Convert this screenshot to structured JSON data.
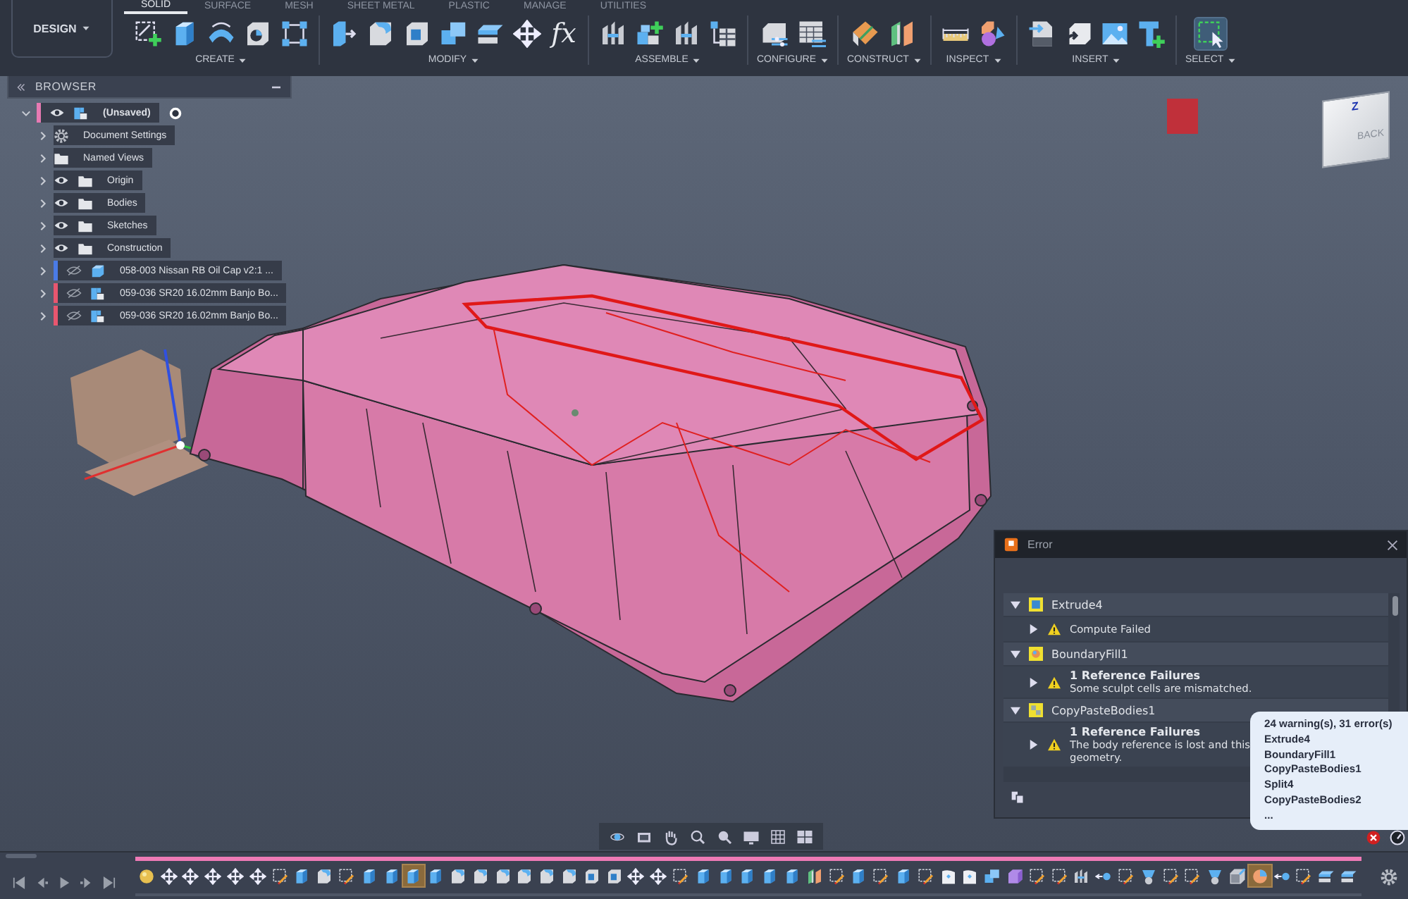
{
  "toolbar": {
    "workspace": "DESIGN",
    "tabs": [
      {
        "label": "SOLID",
        "selected": true
      },
      {
        "label": "SURFACE",
        "selected": false
      },
      {
        "label": "MESH",
        "selected": false
      },
      {
        "label": "SHEET METAL",
        "selected": false
      },
      {
        "label": "PLASTIC",
        "selected": false
      },
      {
        "label": "MANAGE",
        "selected": false
      },
      {
        "label": "UTILITIES",
        "selected": false
      }
    ],
    "groups": [
      {
        "label": "CREATE",
        "tools": [
          {
            "kind": "sketch",
            "selected": false
          },
          {
            "kind": "block",
            "selected": false
          },
          {
            "kind": "arch",
            "selected": false
          },
          {
            "kind": "hole",
            "selected": false
          },
          {
            "kind": "pattern",
            "selected": false
          }
        ]
      },
      {
        "label": "MODIFY",
        "tools": [
          {
            "kind": "presspull",
            "selected": false
          },
          {
            "kind": "fillet",
            "selected": false
          },
          {
            "kind": "shell",
            "selected": false
          },
          {
            "kind": "combine",
            "selected": false
          },
          {
            "kind": "offset",
            "selected": false
          },
          {
            "kind": "move",
            "selected": false
          },
          {
            "kind": "glyph",
            "glyph": "fx",
            "selected": false
          }
        ]
      },
      {
        "label": "ASSEMBLE",
        "tools": [
          {
            "kind": "joint",
            "selected": false
          },
          {
            "kind": "component",
            "selected": false
          },
          {
            "kind": "joint",
            "selected": false
          },
          {
            "kind": "table",
            "selected": false
          }
        ]
      },
      {
        "label": "CONFIGURE",
        "tools": [
          {
            "kind": "config",
            "selected": false
          },
          {
            "kind": "configtable",
            "selected": false
          }
        ]
      },
      {
        "label": "CONSTRUCT",
        "tools": [
          {
            "kind": "plane",
            "selected": false
          },
          {
            "kind": "panels",
            "selected": false
          }
        ]
      },
      {
        "label": "INSPECT",
        "tools": [
          {
            "kind": "measure",
            "selected": false
          },
          {
            "kind": "display",
            "selected": false
          }
        ]
      },
      {
        "label": "INSERT",
        "tools": [
          {
            "kind": "svg",
            "selected": false
          },
          {
            "kind": "decal",
            "selected": false
          },
          {
            "kind": "image",
            "selected": false
          },
          {
            "kind": "textcmd",
            "selected": false
          }
        ]
      },
      {
        "label": "SELECT",
        "tools": [
          {
            "kind": "select",
            "selected": true
          }
        ]
      }
    ]
  },
  "browser": {
    "title": "BROWSER",
    "tree": [
      {
        "label": "(Unsaved)",
        "kind": "component",
        "color": "#e77ab3",
        "visible": true,
        "active": true,
        "expanded": true,
        "children": [
          {
            "label": "Document Settings",
            "kind": "gear",
            "expanded": false
          },
          {
            "label": "Named Views",
            "kind": "folder",
            "expanded": false
          },
          {
            "label": "Origin",
            "kind": "folder",
            "visible": true,
            "expanded": false
          },
          {
            "label": "Bodies",
            "kind": "folder",
            "visible": true,
            "expanded": false
          },
          {
            "label": "Sketches",
            "kind": "folder",
            "visible": true,
            "expanded": false
          },
          {
            "label": "Construction",
            "kind": "folder",
            "visible": true,
            "expanded": false
          },
          {
            "label": "058-003 Nissan RB Oil Cap v2:1 ...",
            "kind": "body",
            "color": "#4a7be6",
            "visible": false,
            "expanded": false
          },
          {
            "label": "059-036 SR20 16.02mm Banjo Bo...",
            "kind": "component",
            "color": "#e8566f",
            "visible": false,
            "expanded": false
          },
          {
            "label": "059-036 SR20 16.02mm Banjo Bo...",
            "kind": "component",
            "color": "#e8566f",
            "visible": false,
            "expanded": false
          }
        ]
      }
    ]
  },
  "viewport": {
    "view_cube": {
      "face": "BACK",
      "axis": "Z"
    }
  },
  "error_dialog": {
    "title": "Error",
    "groups": [
      {
        "name": "Extrude4",
        "kind": "extrude",
        "expanded": true,
        "items": [
          {
            "expanded": false,
            "lines": [
              "Compute Failed"
            ]
          }
        ]
      },
      {
        "name": "BoundaryFill1",
        "kind": "boundary",
        "expanded": true,
        "items": [
          {
            "expanded": false,
            "heading": "1 Reference Failures",
            "lines": [
              "Some sculpt cells are mismatched."
            ]
          }
        ]
      },
      {
        "name": "CopyPasteBodies1",
        "kind": "copy",
        "expanded": true,
        "items": [
          {
            "expanded": false,
            "heading": "1 Reference Failures",
            "lines": [
              "The body reference is lost and this",
              "geometry."
            ]
          }
        ]
      }
    ]
  },
  "tooltip": {
    "lines": [
      "24 warning(s), 31 error(s)",
      "Extrude4",
      "BoundaryFill1",
      "CopyPasteBodies1",
      "Split4",
      "CopyPasteBodies2",
      "..."
    ]
  },
  "timeline": {
    "items": [
      {
        "kind": "appearance",
        "selected": false
      },
      {
        "kind": "move",
        "selected": false
      },
      {
        "kind": "move",
        "selected": false
      },
      {
        "kind": "move",
        "selected": false
      },
      {
        "kind": "move",
        "selected": false
      },
      {
        "kind": "move",
        "selected": false
      },
      {
        "kind": "sketchpen",
        "selected": false
      },
      {
        "kind": "block",
        "selected": false
      },
      {
        "kind": "fillet",
        "selected": false
      },
      {
        "kind": "sketchpen",
        "selected": false
      },
      {
        "kind": "block",
        "selected": false
      },
      {
        "kind": "block",
        "selected": false
      },
      {
        "kind": "block",
        "selected": true
      },
      {
        "kind": "block",
        "selected": false
      },
      {
        "kind": "fillet",
        "selected": false
      },
      {
        "kind": "fillet",
        "selected": false
      },
      {
        "kind": "fillet",
        "selected": false
      },
      {
        "kind": "fillet",
        "selected": false
      },
      {
        "kind": "fillet",
        "selected": false
      },
      {
        "kind": "fillet",
        "selected": false
      },
      {
        "kind": "shell",
        "selected": false
      },
      {
        "kind": "shell",
        "selected": false
      },
      {
        "kind": "move",
        "selected": false
      },
      {
        "kind": "move",
        "selected": false
      },
      {
        "kind": "sketchpen",
        "selected": false
      },
      {
        "kind": "block",
        "selected": false
      },
      {
        "kind": "block",
        "selected": false
      },
      {
        "kind": "block",
        "selected": false
      },
      {
        "kind": "block",
        "selected": false
      },
      {
        "kind": "block",
        "selected": false
      },
      {
        "kind": "panels",
        "selected": false
      },
      {
        "kind": "sketchpen",
        "selected": false
      },
      {
        "kind": "block",
        "selected": false
      },
      {
        "kind": "sketchpen",
        "selected": false
      },
      {
        "kind": "block",
        "selected": false
      },
      {
        "kind": "sketchpen",
        "selected": false
      },
      {
        "kind": "boundary",
        "selected": false
      },
      {
        "kind": "boundary",
        "selected": false
      },
      {
        "kind": "combine",
        "selected": false
      },
      {
        "kind": "box",
        "selected": false
      },
      {
        "kind": "sketchpen",
        "selected": false
      },
      {
        "kind": "sketchpen",
        "selected": false
      },
      {
        "kind": "joint",
        "selected": false
      },
      {
        "kind": "pointarrow",
        "selected": false
      },
      {
        "kind": "sketchpen",
        "selected": false
      },
      {
        "kind": "loft",
        "selected": false
      },
      {
        "kind": "sketchpen",
        "selected": false
      },
      {
        "kind": "sketchpen",
        "selected": false
      },
      {
        "kind": "loft",
        "selected": false
      },
      {
        "kind": "cube",
        "selected": false
      },
      {
        "kind": "paint",
        "selected": true
      },
      {
        "kind": "pointarrow",
        "selected": false
      },
      {
        "kind": "sketchpen",
        "selected": false
      },
      {
        "kind": "layers",
        "selected": false
      },
      {
        "kind": "layers",
        "selected": false
      }
    ]
  }
}
